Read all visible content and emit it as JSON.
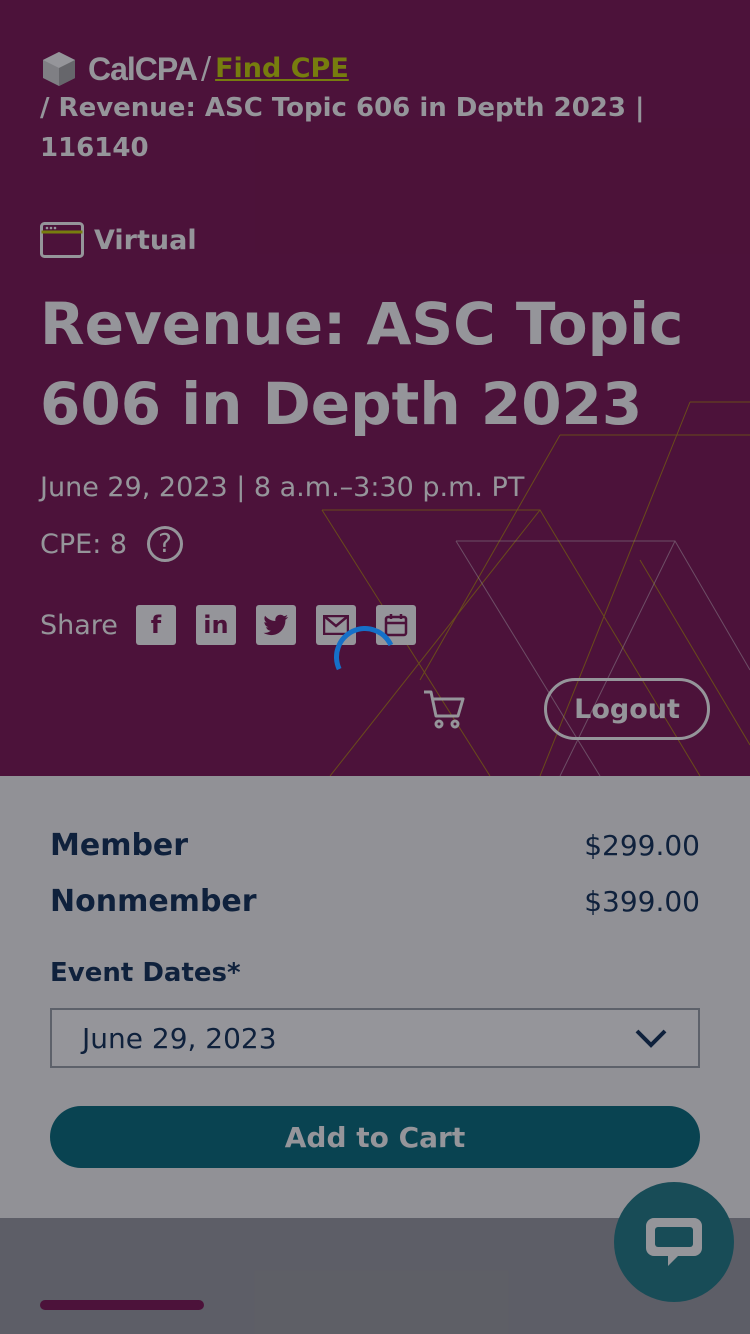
{
  "breadcrumb": {
    "logo_text": "CalCPA",
    "sep1": "/",
    "link": "Find CPE",
    "rest": "/ Revenue: ASC Topic 606 in Depth 2023 | 116140"
  },
  "event": {
    "format": "Virtual",
    "title": "Revenue: ASC Topic 606 in Depth 2023",
    "date": "June 29, 2023 | 8 a.m.–3:30 p.m. PT",
    "cpe": "CPE: 8",
    "share_label": "Share",
    "share_icons": [
      "facebook-icon",
      "linkedin-icon",
      "twitter-icon",
      "email-icon",
      "calendar-icon"
    ]
  },
  "header": {
    "logout_label": "Logout"
  },
  "pricing": {
    "member_label": "Member",
    "member_price": "$299.00",
    "nonmember_label": "Nonmember",
    "nonmember_price": "$399.00"
  },
  "registration": {
    "dates_label": "Event Dates*",
    "selected_date": "June 29, 2023",
    "add_to_cart_label": "Add to Cart"
  },
  "colors": {
    "hero_bg": "#7a1150",
    "link": "#c8d400",
    "navy": "#0b2d55",
    "teal": "#006a7a"
  }
}
